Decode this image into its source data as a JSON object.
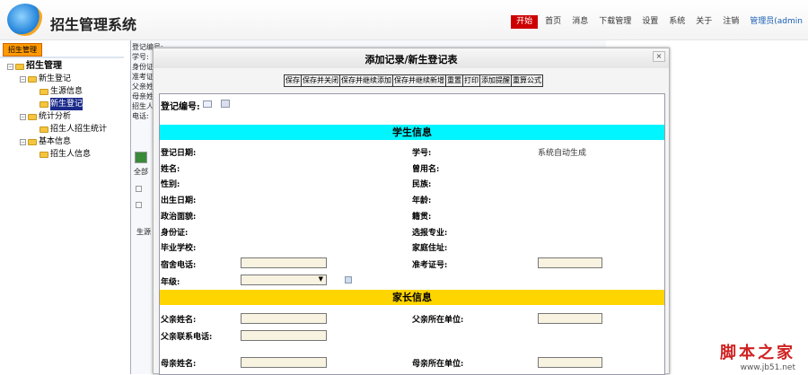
{
  "header": {
    "title": "招生管理系统",
    "nav": [
      "开始",
      "首页",
      "消息",
      "下载管理",
      "设置",
      "系统",
      "关于",
      "注销"
    ],
    "user": "管理员(admin"
  },
  "sidebar": {
    "tab": "招生管理",
    "tree": [
      {
        "label": "招生管理",
        "level": 0,
        "toggle": "⊟"
      },
      {
        "label": "新生登记",
        "level": 1,
        "toggle": "⊟"
      },
      {
        "label": "生源信息",
        "level": 2
      },
      {
        "label": "新生登记",
        "level": 2,
        "selected": true
      },
      {
        "label": "统计分析",
        "level": 1,
        "toggle": "⊟"
      },
      {
        "label": "招生人招生统计",
        "level": 2
      },
      {
        "label": "基本信息",
        "level": 1,
        "toggle": "⊟"
      },
      {
        "label": "招生人信息",
        "level": 2
      }
    ]
  },
  "background": {
    "labels": [
      "登记编号:",
      "学号:",
      "身份证",
      "准考证",
      "父亲姓",
      "母亲姓",
      "招生人",
      "电话:"
    ],
    "all": "全部",
    "tab": "生源"
  },
  "dialog": {
    "title": "添加记录/新生登记表",
    "close": "×",
    "toolbar": [
      "保存",
      "保存并关闭",
      "保存并继续添加",
      "保存并继续新增",
      "重置",
      "打印",
      "添加提醒",
      "重算公式"
    ],
    "reg_no_label": "登记编号:",
    "student_section": "学生信息",
    "left_fields": [
      "登记日期:",
      "姓名:",
      "性别:",
      "出生日期:",
      "政治面貌:",
      "身份证:",
      "毕业学校:",
      "宿舍电话:",
      "年级:"
    ],
    "right_fields": [
      "学号:",
      "曾用名:",
      "民族:",
      "年龄:",
      "籍贯:",
      "选报专业:",
      "家庭住址:",
      "准考证号:"
    ],
    "student_no_value": "系统自动生成",
    "parent_section": "家长信息",
    "father_name": "父亲姓名:",
    "father_unit": "父亲所在单位:",
    "father_phone": "父亲联系电话:",
    "mother_name": "母亲姓名:",
    "mother_unit": "母亲所在单位:"
  },
  "watermark": {
    "name": "脚本之家",
    "url": "www.jb51.net"
  },
  "colors": {
    "student_bar": "#00f5ff",
    "parent_bar": "#ffd500",
    "start": "#cc0000"
  }
}
